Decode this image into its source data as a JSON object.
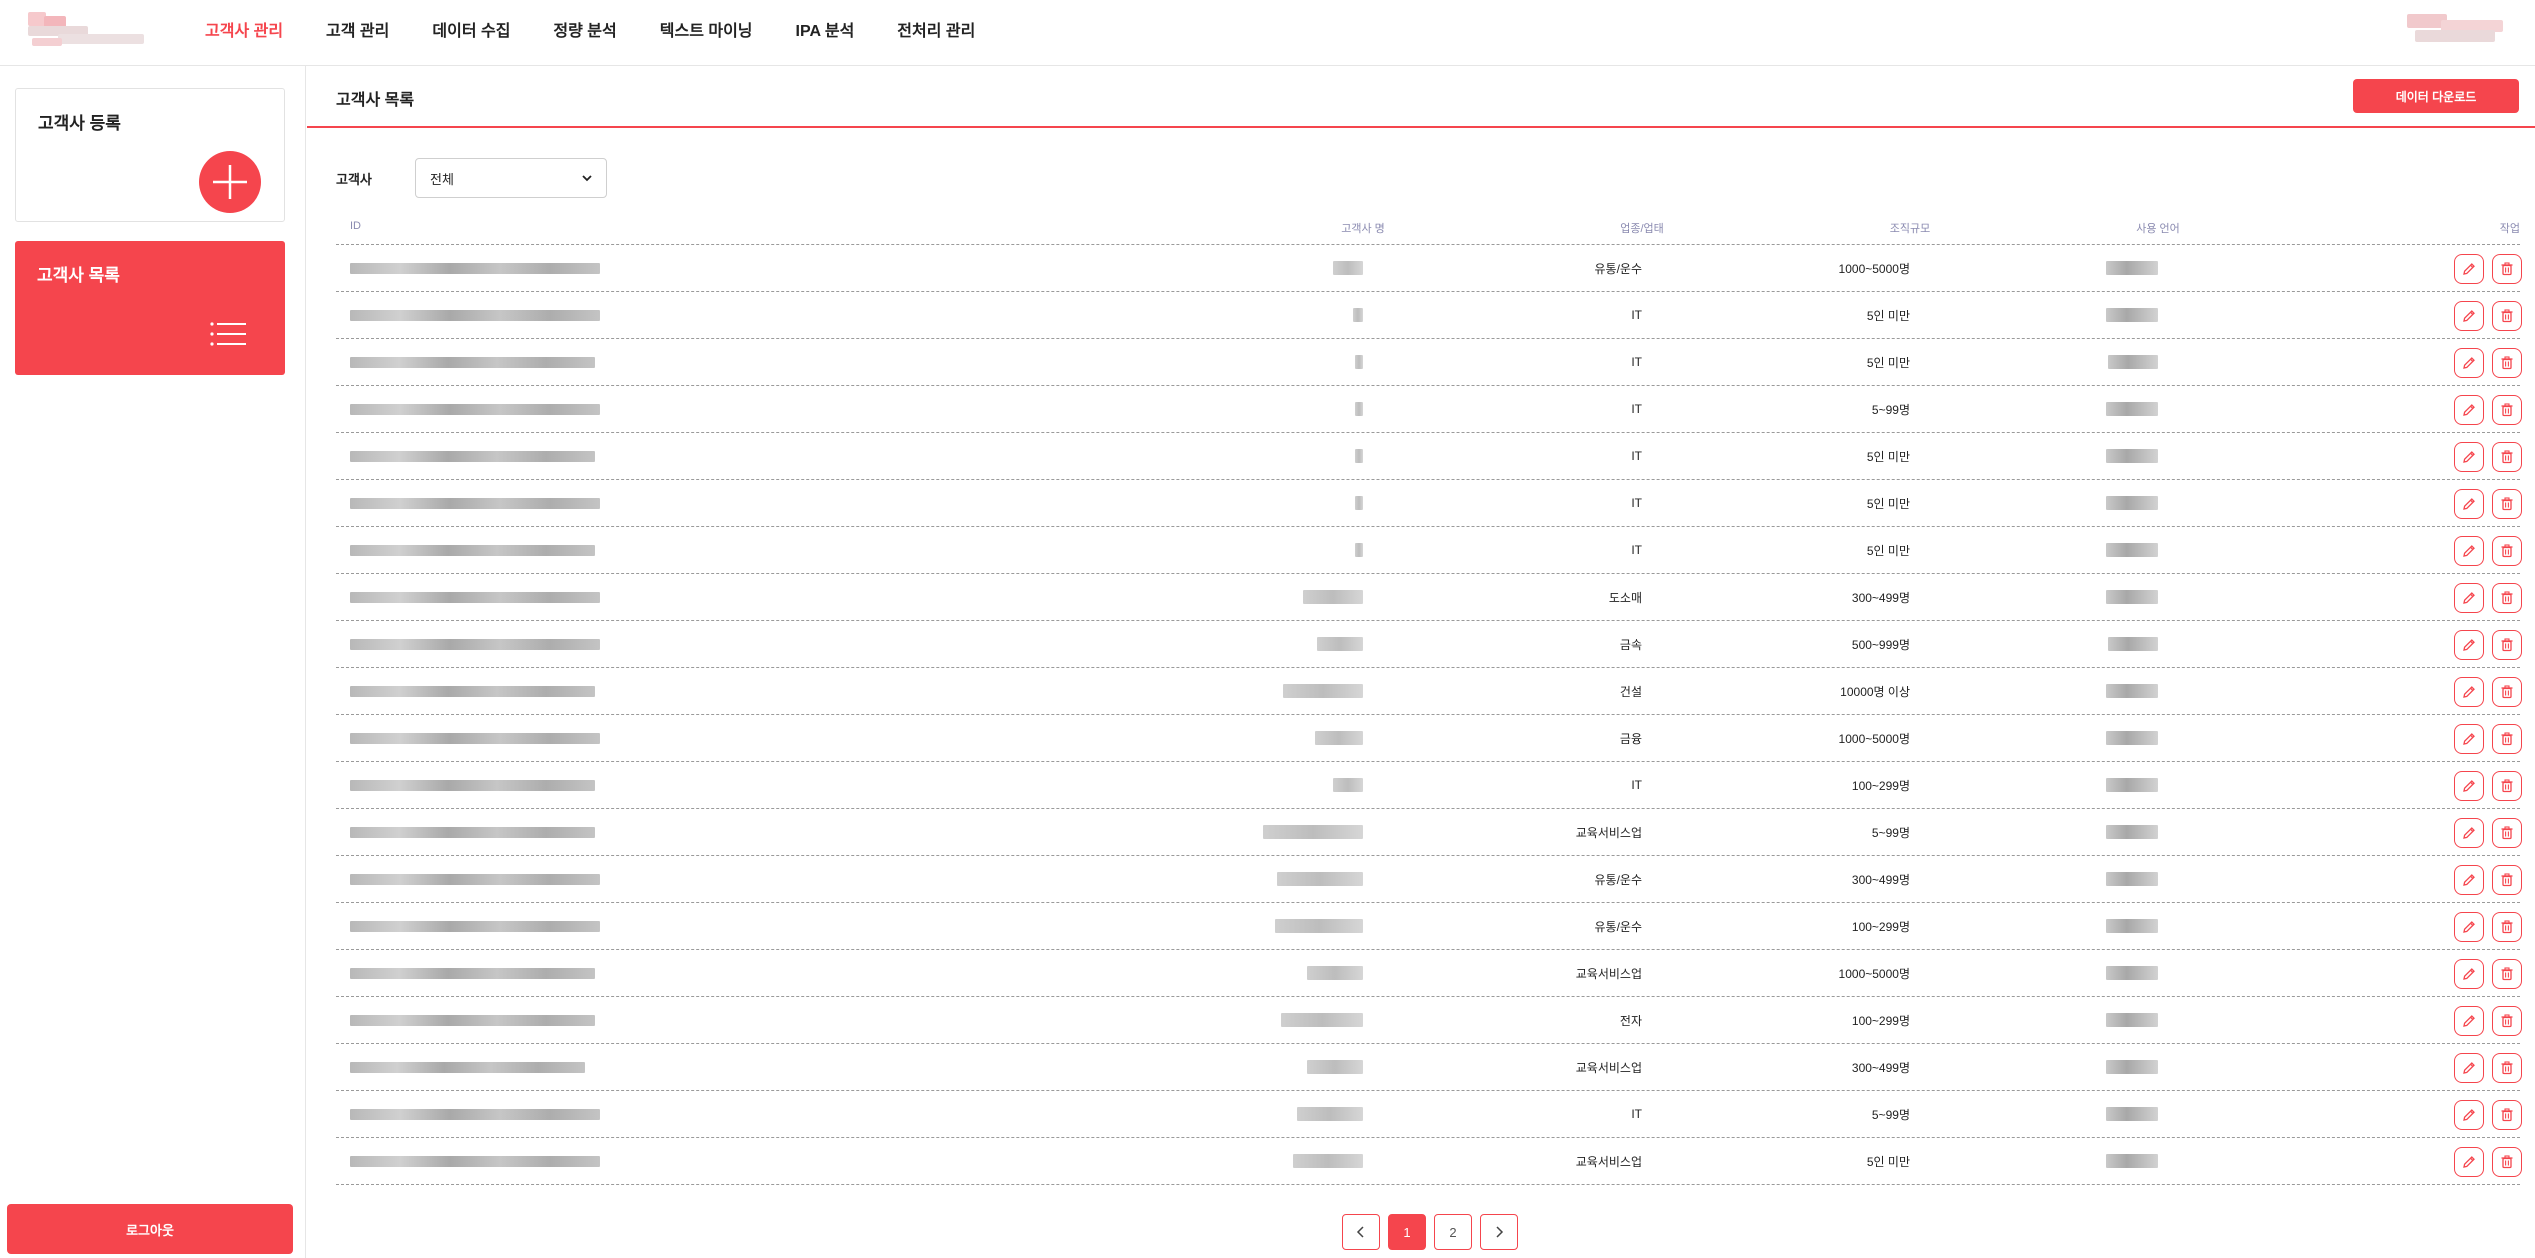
{
  "nav": {
    "items": [
      {
        "label": "고객사 관리",
        "active": true
      },
      {
        "label": "고객 관리",
        "active": false
      },
      {
        "label": "데이터 수집",
        "active": false
      },
      {
        "label": "정량 분석",
        "active": false
      },
      {
        "label": "텍스트 마이닝",
        "active": false
      },
      {
        "label": "IPA 분석",
        "active": false
      },
      {
        "label": "전처리 관리",
        "active": false
      }
    ]
  },
  "sidebar": {
    "register_card": {
      "title": "고객사 등록",
      "icon": "plus-icon"
    },
    "list_card": {
      "title": "고객사 목록",
      "icon": "list-icon"
    },
    "logout_label": "로그아웃"
  },
  "main": {
    "title": "고객사 목록",
    "download_label": "데이터 다운로드",
    "filter": {
      "label": "고객사",
      "selected": "전체"
    },
    "columns": {
      "id": "ID",
      "name": "고객사 명",
      "industry": "업종/업태",
      "size": "조직규모",
      "language": "사용 언어",
      "actions": "작업"
    },
    "rows": [
      {
        "industry": "유통/운수",
        "size": "1000~5000명"
      },
      {
        "industry": "IT",
        "size": "5인 미만"
      },
      {
        "industry": "IT",
        "size": "5인 미만"
      },
      {
        "industry": "IT",
        "size": "5~99명"
      },
      {
        "industry": "IT",
        "size": "5인 미만"
      },
      {
        "industry": "IT",
        "size": "5인 미만"
      },
      {
        "industry": "IT",
        "size": "5인 미만"
      },
      {
        "industry": "도소매",
        "size": "300~499명"
      },
      {
        "industry": "금속",
        "size": "500~999명"
      },
      {
        "industry": "건설",
        "size": "10000명 이상"
      },
      {
        "industry": "금융",
        "size": "1000~5000명"
      },
      {
        "industry": "IT",
        "size": "100~299명"
      },
      {
        "industry": "교육서비스업",
        "size": "5~99명"
      },
      {
        "industry": "유통/운수",
        "size": "300~499명"
      },
      {
        "industry": "유통/운수",
        "size": "100~299명"
      },
      {
        "industry": "교육서비스업",
        "size": "1000~5000명"
      },
      {
        "industry": "전자",
        "size": "100~299명"
      },
      {
        "industry": "교육서비스업",
        "size": "300~499명"
      },
      {
        "industry": "IT",
        "size": "5~99명"
      },
      {
        "industry": "교육서비스업",
        "size": "5인 미만"
      }
    ],
    "row_actions": {
      "edit_icon": "pencil-icon",
      "delete_icon": "trash-icon"
    }
  },
  "pagination": {
    "pages": [
      "1",
      "2"
    ],
    "current": "1"
  },
  "colors": {
    "accent": "#f5454d",
    "blur": "#b9b9b9"
  }
}
